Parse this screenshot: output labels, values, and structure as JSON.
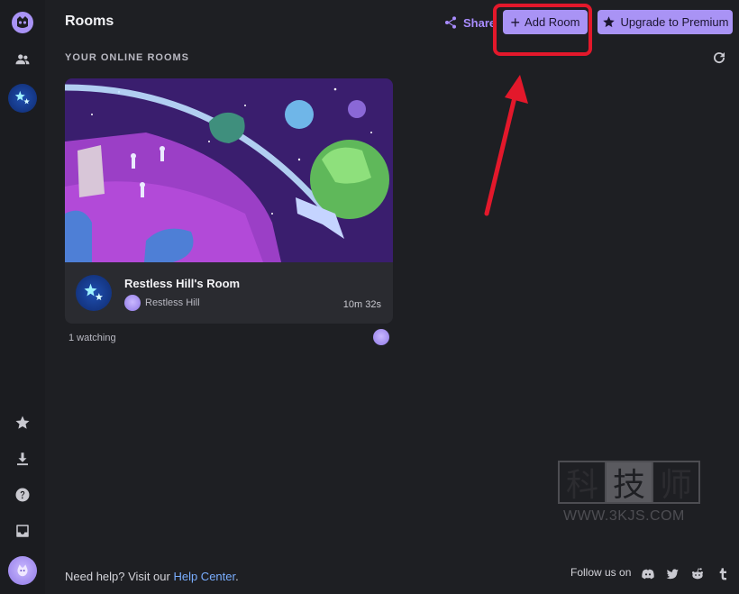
{
  "header": {
    "title": "Rooms",
    "share_label": "Share",
    "add_room_label": "Add Room",
    "premium_label": "Upgrade to Premium"
  },
  "section": {
    "label": "YOUR ONLINE ROOMS"
  },
  "room": {
    "name": "Restless Hill's Room",
    "owner": "Restless Hill",
    "time": "10m 32s",
    "watching": "1 watching"
  },
  "footer": {
    "help_prefix": "Need help? Visit our ",
    "help_link": "Help Center",
    "help_suffix": ".",
    "follow_label": "Follow us on"
  },
  "watermark": {
    "chars": [
      "科",
      "技",
      "师"
    ],
    "url": "WWW.3KJS.COM"
  },
  "icons": {
    "sidebar": [
      "app-logo-icon",
      "friends-icon",
      "room-stars-icon",
      "star-icon",
      "download-icon",
      "help-icon",
      "inbox-icon",
      "user-avatar"
    ],
    "social": [
      "discord-icon",
      "twitter-icon",
      "reddit-icon",
      "tumblr-icon"
    ]
  },
  "colors": {
    "accent": "#a993f5",
    "background": "#1e1f23",
    "highlight": "#e3182b",
    "link": "#7aaeff"
  }
}
